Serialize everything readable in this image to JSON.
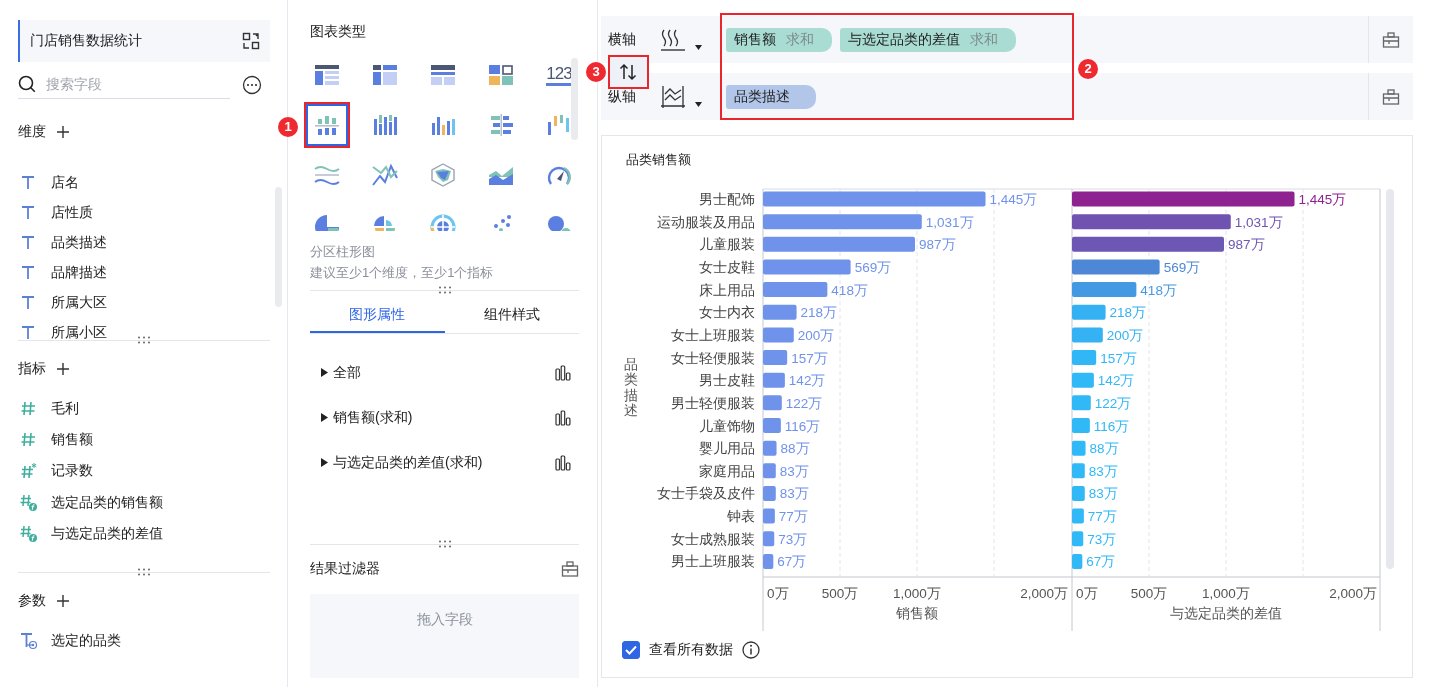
{
  "sidebar": {
    "title": "门店销售数据统计",
    "search": {
      "placeholder": "搜索字段"
    },
    "sections": [
      {
        "title": "维度",
        "items": [
          {
            "kind": "text",
            "label": "店名"
          },
          {
            "kind": "text",
            "label": "店性质"
          },
          {
            "kind": "text",
            "label": "品类描述"
          },
          {
            "kind": "text",
            "label": "品牌描述"
          },
          {
            "kind": "text",
            "label": "所属大区"
          },
          {
            "kind": "text",
            "label": "所属小区"
          }
        ]
      },
      {
        "title": "指标",
        "items": [
          {
            "kind": "number",
            "label": "毛利"
          },
          {
            "kind": "number",
            "label": "销售额"
          },
          {
            "kind": "count",
            "label": "记录数"
          },
          {
            "kind": "formula",
            "label": "选定品类的销售额"
          },
          {
            "kind": "formula",
            "label": "与选定品类的差值"
          }
        ]
      },
      {
        "title": "参数",
        "items": [
          {
            "kind": "parameter",
            "label": "选定的品类"
          }
        ]
      }
    ]
  },
  "chart_types": {
    "title": "图表类型",
    "types": [
      {
        "kind": "table",
        "selected": false
      },
      {
        "kind": "cross-table",
        "selected": false
      },
      {
        "kind": "group-table",
        "selected": false
      },
      {
        "kind": "dashboard",
        "selected": false
      },
      {
        "kind": "number",
        "label": "123",
        "selected": false
      },
      {
        "kind": "partition-bar",
        "selected": true
      },
      {
        "kind": "stacked-bar",
        "selected": false
      },
      {
        "kind": "multi-bar",
        "selected": false
      },
      {
        "kind": "diverging-bar",
        "selected": false
      },
      {
        "kind": "range-bar",
        "selected": false
      },
      {
        "kind": "wave",
        "selected": false
      },
      {
        "kind": "line",
        "selected": false
      },
      {
        "kind": "radar",
        "selected": false
      },
      {
        "kind": "area",
        "selected": false
      },
      {
        "kind": "gauge",
        "selected": false
      },
      {
        "kind": "pie",
        "selected": false
      },
      {
        "kind": "rose",
        "selected": false
      },
      {
        "kind": "multi-pie",
        "selected": false
      },
      {
        "kind": "scatter",
        "selected": false
      },
      {
        "kind": "bubble",
        "selected": false
      }
    ],
    "selected_name": "分区柱形图",
    "hint": "建议至少1个维度，至少1个指标"
  },
  "tabs": [
    {
      "label": "图形属性",
      "selected": true
    },
    {
      "label": "组件样式",
      "selected": false
    }
  ],
  "properties": [
    {
      "label": "全部"
    },
    {
      "label": "销售额(求和)"
    },
    {
      "label": "与选定品类的差值(求和)"
    }
  ],
  "filter": {
    "title": "结果过滤器",
    "placeholder": "拖入字段"
  },
  "axes": [
    {
      "label": "横轴",
      "kind": "horizontal",
      "fields": [
        {
          "kind": "measure",
          "name": "销售额",
          "aggregation": "求和"
        },
        {
          "kind": "measure",
          "name": "与选定品类的差值",
          "aggregation": "求和"
        }
      ]
    },
    {
      "label": "纵轴",
      "kind": "vertical",
      "fields": [
        {
          "kind": "dimension",
          "name": "品类描述"
        }
      ]
    }
  ],
  "annotations": [
    {
      "kind": "chart-type",
      "number": "1"
    },
    {
      "kind": "swap",
      "number": "3"
    },
    {
      "kind": "fields",
      "number": "2"
    }
  ],
  "chart_card": {
    "title": "品类销售额",
    "panels": [
      {
        "chart_data": {
          "type": "bar",
          "orientation": "horizontal",
          "ylabel": "品类描述",
          "xlabel": "销售额",
          "categories": [
            "男士配饰",
            "运动服装及用品",
            "儿童服装",
            "女士皮鞋",
            "床上用品",
            "女士内衣",
            "女士上班服装",
            "女士轻便服装",
            "男士皮鞋",
            "男士轻便服装",
            "儿童饰物",
            "婴儿用品",
            "家庭用品",
            "女士手袋及皮件",
            "钟表",
            "女士成熟服装",
            "男士上班服装"
          ],
          "series": [
            {
              "color": "#6f92ea",
              "values": [
                1445,
                1031,
                987,
                569,
                418,
                218,
                200,
                157,
                142,
                122,
                116,
                88,
                83,
                83,
                77,
                73,
                67
              ]
            }
          ],
          "value_labels": [
            "1,445万",
            "1,031万",
            "987万",
            "569万",
            "418万",
            "218万",
            "200万",
            "157万",
            "142万",
            "122万",
            "116万",
            "88万",
            "83万",
            "83万",
            "77万",
            "73万",
            "67万"
          ],
          "xlim": [
            0,
            2000
          ],
          "xticks": [
            {
              "value": 0,
              "label": "0万"
            },
            {
              "value": 500,
              "label": "500万"
            },
            {
              "value": 1000,
              "label": "1,000万"
            },
            {
              "value": 2000,
              "label": "2,000万"
            }
          ]
        }
      },
      {
        "chart_data": {
          "type": "bar",
          "orientation": "horizontal",
          "xlabel": "与选定品类的差值",
          "series": [
            {
              "colors": [
                "#8e2290",
                "#7052b1",
                "#6d57b4",
                "#4e87d6",
                "#4399e2",
                "#35b0f2",
                "#34b2f3",
                "#31b7f6",
                "#30b8f7",
                "#30b8f7",
                "#30b8f7",
                "#30b8f7",
                "#30b8f7",
                "#30b8f7",
                "#30b8f7",
                "#30b8f7",
                "#30b8f7"
              ],
              "values": [
                1445,
                1031,
                987,
                569,
                418,
                218,
                200,
                157,
                142,
                122,
                116,
                88,
                83,
                83,
                77,
                73,
                67
              ]
            }
          ],
          "value_labels": [
            "1,445万",
            "1,031万",
            "987万",
            "569万",
            "418万",
            "218万",
            "200万",
            "157万",
            "142万",
            "122万",
            "116万",
            "88万",
            "83万",
            "83万",
            "77万",
            "73万",
            "67万"
          ],
          "xlim": [
            0,
            2000
          ],
          "xticks": [
            {
              "value": 0,
              "label": "0万"
            },
            {
              "value": 500,
              "label": "500万"
            },
            {
              "value": 1000,
              "label": "1,000万"
            },
            {
              "value": 2000,
              "label": "2,000万"
            }
          ]
        }
      }
    ],
    "show_all": {
      "label": "查看所有数据",
      "checked": true
    }
  }
}
